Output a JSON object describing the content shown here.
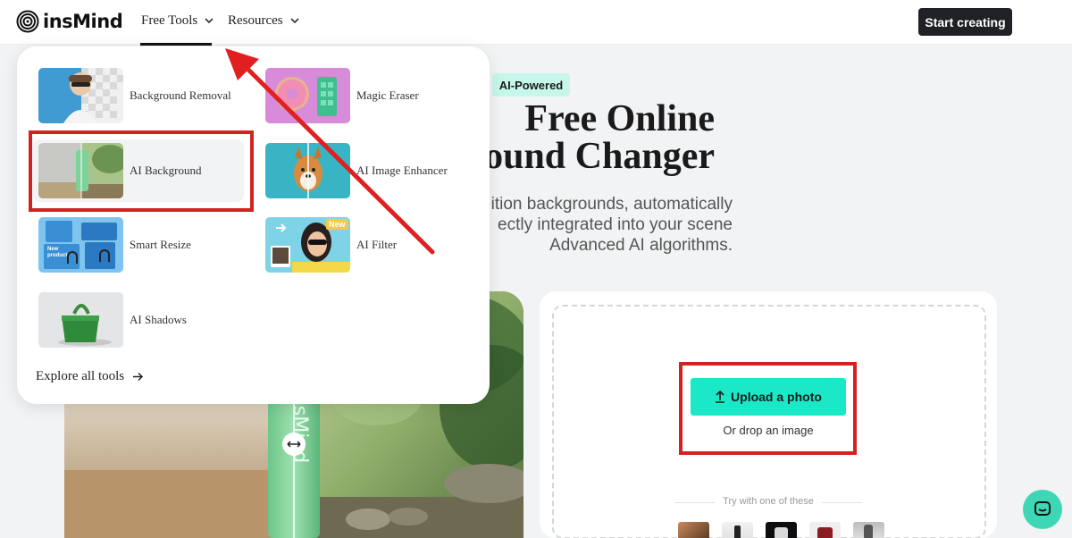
{
  "header": {
    "logo_text": "insMind",
    "nav": [
      {
        "label": "Free Tools"
      },
      {
        "label": "Resources"
      }
    ],
    "cta_label": "Start creating"
  },
  "hero": {
    "badge": "AI-Powered",
    "title_line1": "Free Online",
    "title_line2": "ound Changer",
    "desc_line1": "ition backgrounds, automatically",
    "desc_line2": "ectly integrated into your scene",
    "desc_line3": "Advanced AI algorithms."
  },
  "dropdown": {
    "tools": [
      {
        "label": "Background Removal"
      },
      {
        "label": "Magic Eraser"
      },
      {
        "label": "AI Background"
      },
      {
        "label": "AI Image Enhancer"
      },
      {
        "label": "Smart Resize"
      },
      {
        "label": "AI Filter"
      },
      {
        "label": "AI Shadows"
      }
    ],
    "new_badge": "New",
    "smart_resize_tag": "New product",
    "explore_label": "Explore all tools"
  },
  "upload": {
    "button_label": "Upload a photo",
    "drop_text": "Or drop an image",
    "try_text": "Try with one of these"
  },
  "hero_image": {
    "brand_text": "insMind"
  },
  "colors": {
    "accent": "#1be8c6",
    "badge_bg": "#c6f7ea",
    "annotation_red": "#d42222",
    "dark_button": "#1f2124"
  }
}
